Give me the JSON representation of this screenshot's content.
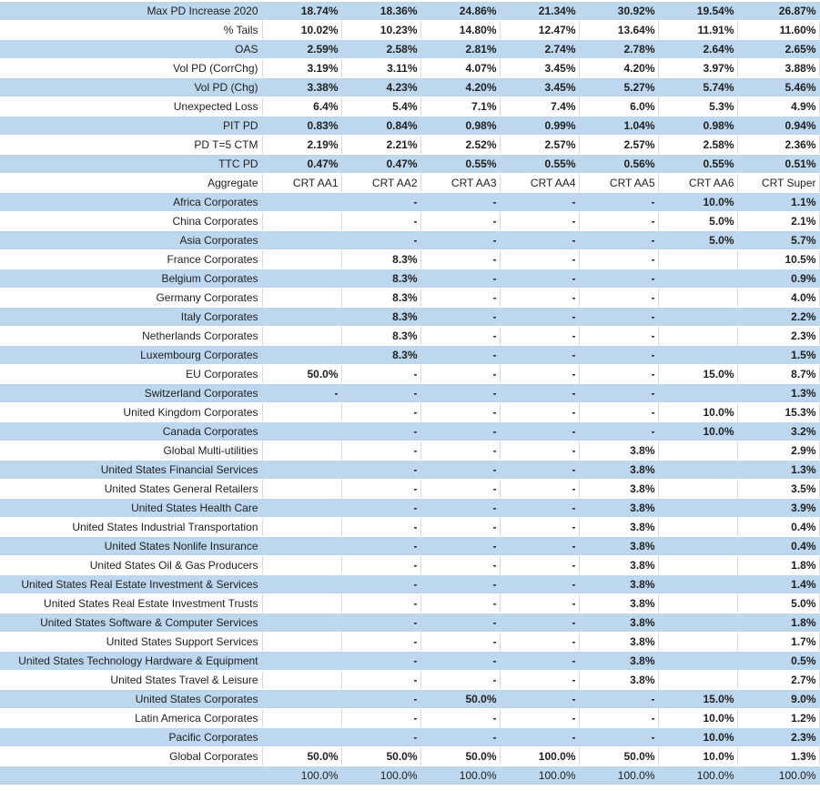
{
  "sheet": {
    "columns": [
      "",
      "CRT AA1",
      "CRT AA2",
      "CRT AA3",
      "CRT AA4",
      "CRT AA5",
      "CRT AA6",
      "CRT Super"
    ],
    "colors": {
      "band": "#bdd7ee",
      "plain": "#ffffff",
      "gridline": "#d9d9d9"
    },
    "metric_rows": [
      {
        "label": "Max PD Increase 2020",
        "values": [
          "18.74%",
          "18.36%",
          "24.86%",
          "21.34%",
          "30.92%",
          "19.54%",
          "26.87%"
        ]
      },
      {
        "label": "% Tails",
        "values": [
          "10.02%",
          "10.23%",
          "14.80%",
          "12.47%",
          "13.64%",
          "11.91%",
          "11.60%"
        ]
      },
      {
        "label": "OAS",
        "values": [
          "2.59%",
          "2.58%",
          "2.81%",
          "2.74%",
          "2.78%",
          "2.64%",
          "2.65%"
        ]
      },
      {
        "label": "Vol PD (CorrChg)",
        "values": [
          "3.19%",
          "3.11%",
          "4.07%",
          "3.45%",
          "4.20%",
          "3.97%",
          "3.88%"
        ]
      },
      {
        "label": "Vol PD (Chg)",
        "values": [
          "3.38%",
          "4.23%",
          "4.20%",
          "3.45%",
          "5.27%",
          "5.74%",
          "5.46%"
        ]
      },
      {
        "label": "Unexpected Loss",
        "values": [
          "6.4%",
          "5.4%",
          "7.1%",
          "7.4%",
          "6.0%",
          "5.3%",
          "4.9%"
        ]
      },
      {
        "label": "PIT PD",
        "values": [
          "0.83%",
          "0.84%",
          "0.98%",
          "0.99%",
          "1.04%",
          "0.98%",
          "0.94%"
        ]
      },
      {
        "label": "PD T=5 CTM",
        "values": [
          "2.19%",
          "2.21%",
          "2.52%",
          "2.57%",
          "2.57%",
          "2.58%",
          "2.36%"
        ]
      },
      {
        "label": "TTC PD",
        "values": [
          "0.47%",
          "0.47%",
          "0.55%",
          "0.55%",
          "0.56%",
          "0.55%",
          "0.51%"
        ]
      }
    ],
    "header_row": {
      "label": "Aggregate",
      "values": [
        "CRT AA1",
        "CRT AA2",
        "CRT AA3",
        "CRT AA4",
        "CRT AA5",
        "CRT AA6",
        "CRT Super"
      ]
    },
    "allocation_rows": [
      {
        "label": "Africa Corporates",
        "values": [
          "",
          "-",
          "-",
          "-",
          "-",
          "10.0%",
          "1.1%"
        ]
      },
      {
        "label": "China Corporates",
        "values": [
          "",
          "-",
          "-",
          "-",
          "-",
          "5.0%",
          "2.1%"
        ]
      },
      {
        "label": "Asia Corporates",
        "values": [
          "",
          "-",
          "-",
          "-",
          "-",
          "5.0%",
          "5.7%"
        ]
      },
      {
        "label": "France Corporates",
        "values": [
          "",
          "8.3%",
          "-",
          "-",
          "-",
          "",
          "10.5%"
        ]
      },
      {
        "label": "Belgium Corporates",
        "values": [
          "",
          "8.3%",
          "-",
          "-",
          "-",
          "",
          "0.9%"
        ]
      },
      {
        "label": "Germany Corporates",
        "values": [
          "",
          "8.3%",
          "-",
          "-",
          "-",
          "",
          "4.0%"
        ]
      },
      {
        "label": "Italy Corporates",
        "values": [
          "",
          "8.3%",
          "-",
          "-",
          "-",
          "",
          "2.2%"
        ]
      },
      {
        "label": "Netherlands Corporates",
        "values": [
          "",
          "8.3%",
          "-",
          "-",
          "-",
          "",
          "2.3%"
        ]
      },
      {
        "label": "Luxembourg Corporates",
        "values": [
          "",
          "8.3%",
          "-",
          "-",
          "-",
          "",
          "1.5%"
        ]
      },
      {
        "label": "EU Corporates",
        "values": [
          "50.0%",
          "-",
          "-",
          "-",
          "-",
          "15.0%",
          "8.7%"
        ]
      },
      {
        "label": "Switzerland Corporates",
        "values": [
          "-",
          "-",
          "-",
          "-",
          "-",
          "",
          "1.3%"
        ]
      },
      {
        "label": "United Kingdom Corporates",
        "values": [
          "",
          "-",
          "-",
          "-",
          "-",
          "10.0%",
          "15.3%"
        ]
      },
      {
        "label": "Canada Corporates",
        "values": [
          "",
          "-",
          "-",
          "-",
          "-",
          "10.0%",
          "3.2%"
        ]
      },
      {
        "label": "Global Multi-utilities",
        "values": [
          "",
          "-",
          "-",
          "-",
          "3.8%",
          "",
          "2.9%"
        ]
      },
      {
        "label": "United States Financial Services",
        "values": [
          "",
          "-",
          "-",
          "-",
          "3.8%",
          "",
          "1.3%"
        ]
      },
      {
        "label": "United States General Retailers",
        "values": [
          "",
          "-",
          "-",
          "-",
          "3.8%",
          "",
          "3.5%"
        ]
      },
      {
        "label": "United States Health Care",
        "values": [
          "",
          "-",
          "-",
          "-",
          "3.8%",
          "",
          "3.9%"
        ]
      },
      {
        "label": "United States Industrial Transportation",
        "values": [
          "",
          "-",
          "-",
          "-",
          "3.8%",
          "",
          "0.4%"
        ]
      },
      {
        "label": "United States Nonlife Insurance",
        "values": [
          "",
          "-",
          "-",
          "-",
          "3.8%",
          "",
          "0.4%"
        ]
      },
      {
        "label": "United States Oil & Gas Producers",
        "values": [
          "",
          "-",
          "-",
          "-",
          "3.8%",
          "",
          "1.8%"
        ]
      },
      {
        "label": "United States Real Estate Investment & Services",
        "values": [
          "",
          "-",
          "-",
          "-",
          "3.8%",
          "",
          "1.4%"
        ]
      },
      {
        "label": "United States Real Estate Investment Trusts",
        "values": [
          "",
          "-",
          "-",
          "-",
          "3.8%",
          "",
          "5.0%"
        ]
      },
      {
        "label": "United States Software & Computer Services",
        "values": [
          "",
          "-",
          "-",
          "-",
          "3.8%",
          "",
          "1.8%"
        ]
      },
      {
        "label": "United States Support Services",
        "values": [
          "",
          "-",
          "-",
          "-",
          "3.8%",
          "",
          "1.7%"
        ]
      },
      {
        "label": "United States Technology Hardware & Equipment",
        "values": [
          "",
          "-",
          "-",
          "-",
          "3.8%",
          "",
          "0.5%"
        ]
      },
      {
        "label": "United States Travel & Leisure",
        "values": [
          "",
          "-",
          "-",
          "-",
          "3.8%",
          "",
          "2.7%"
        ]
      },
      {
        "label": "United States Corporates",
        "values": [
          "",
          "-",
          "50.0%",
          "-",
          "-",
          "15.0%",
          "9.0%"
        ]
      },
      {
        "label": "Latin America Corporates",
        "values": [
          "",
          "-",
          "-",
          "-",
          "-",
          "10.0%",
          "1.2%"
        ]
      },
      {
        "label": "Pacific Corporates",
        "values": [
          "",
          "-",
          "-",
          "-",
          "-",
          "10.0%",
          "2.3%"
        ]
      },
      {
        "label": "Global Corporates",
        "values": [
          "50.0%",
          "50.0%",
          "50.0%",
          "100.0%",
          "50.0%",
          "10.0%",
          "1.3%"
        ]
      }
    ],
    "total_row": {
      "label": "",
      "values": [
        "100.0%",
        "100.0%",
        "100.0%",
        "100.0%",
        "100.0%",
        "100.0%",
        "100.0%"
      ]
    }
  }
}
